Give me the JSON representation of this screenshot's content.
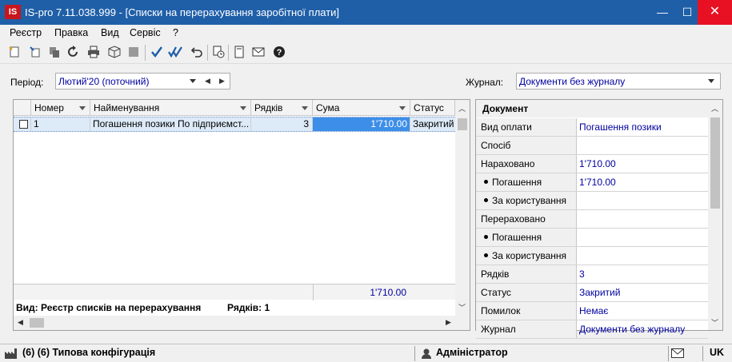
{
  "app": {
    "logo": "IS",
    "title": "IS-pro 7.11.038.999 - [Списки на перерахування заробітної плати]"
  },
  "window_controls": {
    "minimize": "—",
    "maximize": "☐",
    "close": "✕"
  },
  "menu": [
    "Реєстр",
    "Правка",
    "Вид",
    "Сервіс",
    "?"
  ],
  "toolbar": {
    "icons": [
      "new-doc-icon",
      "new-doc-copy-icon",
      "delete-icon",
      "refresh-icon",
      "print-icon",
      "cube-icon",
      "save-disabled-icon",
      "check-icon",
      "double-check-icon",
      "undo-icon",
      "calc-icon",
      "page-icon",
      "mail-icon",
      "help-icon"
    ]
  },
  "filters": {
    "period_label": "Період:",
    "period_value": "Лютий'20 (поточний)",
    "journal_label": "Журнал:",
    "journal_value": "Документи без журналу"
  },
  "grid": {
    "columns": [
      "Номер",
      "Найменування",
      "Рядків",
      "Сума",
      "Статус"
    ],
    "rows": [
      {
        "number": "1",
        "name": "Погашення позики По підприємст...",
        "rows_count": "3",
        "sum": "1'710.00",
        "status": "Закритий"
      }
    ],
    "total_sum": "1'710.00",
    "view_label": "Вид: Реєстр списків на перерахування",
    "rows_label": "Рядків: 1"
  },
  "panel": {
    "header": "Документ",
    "rows": [
      {
        "label": "Вид оплати",
        "value": "Погашення позики",
        "bullet": false
      },
      {
        "label": "Спосіб",
        "value": "",
        "bullet": false
      },
      {
        "label": "Нараховано",
        "value": "1'710.00",
        "bullet": false
      },
      {
        "label": "Погашення",
        "value": "1'710.00",
        "bullet": true
      },
      {
        "label": "За користування",
        "value": "",
        "bullet": true
      },
      {
        "label": "Перераховано",
        "value": "",
        "bullet": false
      },
      {
        "label": "Погашення",
        "value": "",
        "bullet": true
      },
      {
        "label": "За користування",
        "value": "",
        "bullet": true
      },
      {
        "label": "Рядків",
        "value": "3",
        "bullet": false
      },
      {
        "label": "Статус",
        "value": "Закритий",
        "bullet": false
      },
      {
        "label": "Помилок",
        "value": "Немає",
        "bullet": false
      },
      {
        "label": "Журнал",
        "value": "Документи без журналу",
        "bullet": false
      }
    ]
  },
  "statusbar": {
    "config": "(6) (6) Типова конфігурація",
    "user": "Адміністратор",
    "lang": "UK"
  }
}
